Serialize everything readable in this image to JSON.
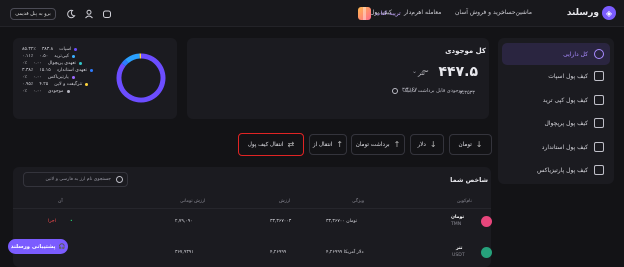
{
  "header": {
    "brand": "ورسلند",
    "nav": [
      "ماشین‌حساب",
      "خرید و فروش آسان",
      "معامله اهرم‌دار",
      "کیف پول"
    ],
    "book_label": "تریبه کتاب",
    "old_panel": "برو به پنل قدیمی"
  },
  "sidebar": {
    "items": [
      {
        "label": "کل دارایی",
        "active": true
      },
      {
        "label": "کیف پول اسپات",
        "active": false
      },
      {
        "label": "کیف پول کپی ترید",
        "active": false
      },
      {
        "label": "کیف پول پرپچوال",
        "active": false
      },
      {
        "label": "کیف پول استاندارد",
        "active": false
      },
      {
        "label": "کیف پول پارتیزیاکس",
        "active": false
      }
    ]
  },
  "balance": {
    "title": "کل موجودی",
    "amount": "۴۴۷.۵",
    "tilde": "~",
    "currency": "تتر",
    "sub_value": "۸،۳۵۳۳",
    "sub_label": "موجودی قابل برداشت ماینیگ",
    "sub_value2": "۳،۴۱۶۷"
  },
  "legend": [
    {
      "label": "اسپات",
      "value": "۳۸۳.۸",
      "pct": "۸۵.۳۲٪",
      "color": "#6c4dff"
    },
    {
      "label": "کپی‌ترید",
      "value": "۰.۵۰",
      "pct": "۰.۱۱٪",
      "color": "#3ab0ff"
    },
    {
      "label": "تعهدی پرپچوال",
      "value": "۰.۰۰",
      "pct": "۰٪",
      "color": "#33c6c8"
    },
    {
      "label": "تعهدی استاندارد",
      "value": "۱۵.۱۵",
      "pct": "۳.۳۸٪",
      "color": "#2e7bff"
    },
    {
      "label": "پارتیزیاکس",
      "value": "۰.۰۰",
      "pct": "۰٪",
      "color": "#9d6bff"
    },
    {
      "label": "تترگیفت و لاین",
      "value": "۴.۲۵",
      "pct": "۰.۹۵٪",
      "color": "#ffd43b"
    },
    {
      "label": "موجودی",
      "value": "۰.۰۰",
      "pct": "۰٪",
      "color": "#b5b5bf"
    }
  ],
  "donut": {
    "shares": [
      85.32,
      0.11,
      0,
      3.38,
      0,
      10.24,
      0.95
    ],
    "colors": [
      "#6c4dff",
      "#3ab0ff",
      "#33c6c8",
      "#2e7bff",
      "#9d6bff",
      "#2aa0ff",
      "#ffd43b"
    ]
  },
  "actions": {
    "toman": "تومان",
    "dollar": "دلار",
    "withdraw": "برداشت تومان",
    "deposit": "انتقال از",
    "transfer": "انتقال کیف پول"
  },
  "table": {
    "title": "شاخص شما",
    "search_placeholder": "جستجوی نام ارز به فارسی و لاتین",
    "headers": [
      "نام‌کوین",
      "ویژگی",
      "ارزش",
      "ارزش تومانی",
      "آن"
    ],
    "rows": [
      {
        "coin": "تومان",
        "sub": "TMN",
        "f1": "۳۳,۳۶۷۰۰ تومان",
        "f2": "۳۳,۳۶۷۰۰۳",
        "f3": "۲,۷۹,۰۹۰",
        "action": "اجرا",
        "icon_color": "#e8467c"
      },
      {
        "coin": "تتر",
        "sub": "USDT",
        "f1": "دلار آمریکا ۴,۲۶۹۹۹",
        "f2": "۴,۲۶۹۹۹",
        "f3": "۳۶۷,۹۳۹۱",
        "action": "",
        "icon_color": "#26a17b"
      }
    ]
  },
  "support": {
    "label": "پشتیبانی ورسلند"
  }
}
